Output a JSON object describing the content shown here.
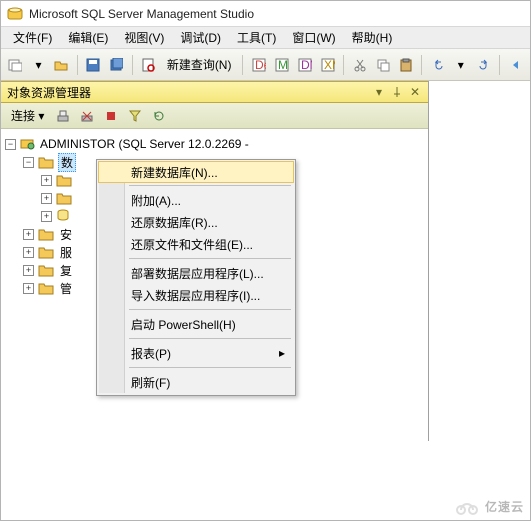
{
  "app": {
    "title": "Microsoft SQL Server Management Studio"
  },
  "menubar": {
    "file": "文件(F)",
    "edit": "编辑(E)",
    "view": "视图(V)",
    "debug": "调试(D)",
    "tools": "工具(T)",
    "window": "窗口(W)",
    "help": "帮助(H)"
  },
  "toolbar": {
    "new_query": "新建查询(N)"
  },
  "explorer": {
    "title": "对象资源管理器",
    "connect": "连接 ▾",
    "server_label": "ADMINISTOR (SQL Server 12.0.2269 -",
    "roots": [
      "数",
      "安",
      "服",
      "复",
      "管"
    ]
  },
  "context_menu": {
    "new_db": "新建数据库(N)...",
    "attach": "附加(A)...",
    "restore_db": "还原数据库(R)...",
    "restore_files": "还原文件和文件组(E)...",
    "deploy_data_tier": "部署数据层应用程序(L)...",
    "import_data_tier": "导入数据层应用程序(I)...",
    "start_ps": "启动 PowerShell(H)",
    "reports": "报表(P)",
    "refresh": "刷新(F)"
  },
  "watermark": "亿速云"
}
